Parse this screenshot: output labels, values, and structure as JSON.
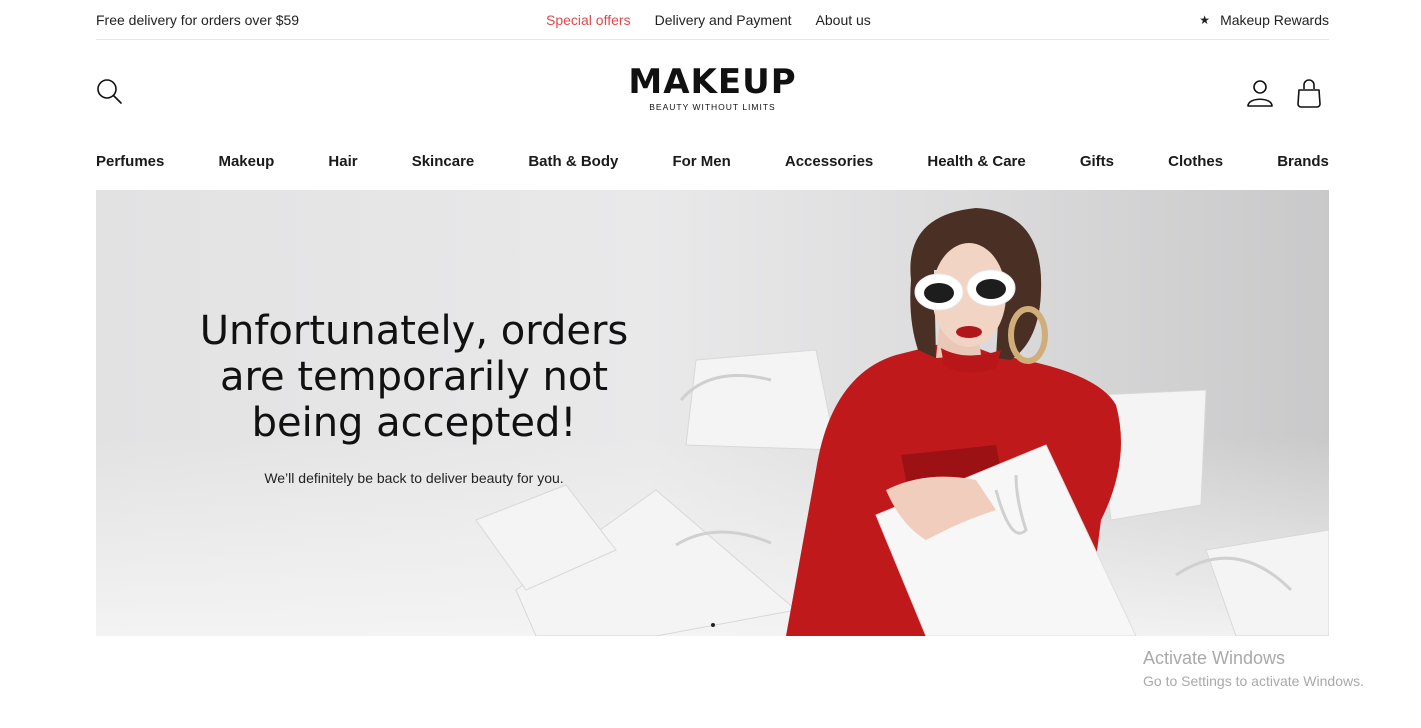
{
  "topbar": {
    "promo": "Free delivery for orders over $59",
    "links": [
      {
        "label": "Special offers",
        "accent": true
      },
      {
        "label": "Delivery and Payment",
        "accent": false
      },
      {
        "label": "About us",
        "accent": false
      }
    ],
    "rewards": "Makeup Rewards"
  },
  "header": {
    "logo_text": "MAKEUP",
    "logo_tagline": "BEAUTY WITHOUT LIMITS",
    "icons": [
      "search-icon",
      "user-icon",
      "bag-icon"
    ]
  },
  "nav": {
    "items": [
      "Perfumes",
      "Makeup",
      "Hair",
      "Skincare",
      "Bath & Body",
      "For Men",
      "Accessories",
      "Health & Care",
      "Gifts",
      "Clothes",
      "Brands"
    ]
  },
  "hero": {
    "title": "Unfortunately, orders are temporarily not being accepted!",
    "subtitle": "We’ll definitely be back to deliver beauty for you."
  },
  "watermark": {
    "line1": "Activate Windows",
    "line2": "Go to Settings to activate Windows."
  },
  "colors": {
    "accent": "#e0484d",
    "text": "#111111",
    "jacket": "#c0191c",
    "hero_bg": "#e4e4e5"
  }
}
